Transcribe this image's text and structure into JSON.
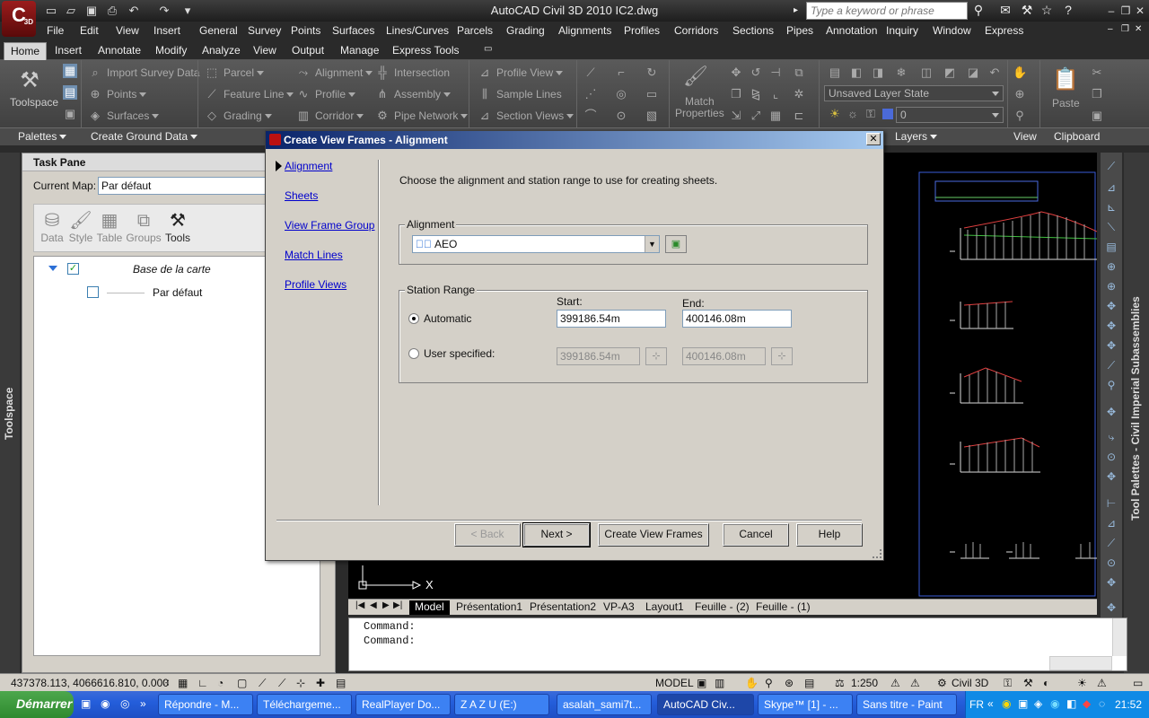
{
  "window": {
    "title": "AutoCAD Civil 3D 2010     IC2.dwg",
    "logo_sub": "3D",
    "search_placeholder": "Type a keyword or phrase"
  },
  "menubar": [
    "File",
    "Edit",
    "View",
    "Insert",
    "General",
    "Survey",
    "Points",
    "Surfaces",
    "Lines/Curves",
    "Parcels",
    "Grading",
    "Alignments",
    "Profiles",
    "Corridors",
    "Sections",
    "Pipes",
    "Annotation",
    "Inquiry",
    "Window",
    "Express"
  ],
  "ribbon_tabs": [
    "Home",
    "Insert",
    "Annotate",
    "Modify",
    "Analyze",
    "View",
    "Output",
    "Manage",
    "Express Tools"
  ],
  "ribbon": {
    "toolspace": "Toolspace",
    "import_survey": "Import Survey Data",
    "points": "Points",
    "surfaces": "Surfaces",
    "parcel": "Parcel",
    "feature_line": "Feature Line",
    "grading": "Grading",
    "alignment": "Alignment",
    "profile": "Profile",
    "corridor": "Corridor",
    "intersection": "Intersection",
    "assembly": "Assembly",
    "pipe_network": "Pipe Network",
    "profile_view": "Profile View",
    "sample_lines": "Sample Lines",
    "section_views": "Section Views",
    "match_properties": "Match\nProperties",
    "layer_state": "Unsaved Layer State",
    "layer_value": "0",
    "paste": "Paste",
    "panels": [
      "Palettes",
      "Create Ground Data",
      "Layers",
      "View",
      "Clipboard"
    ]
  },
  "left_strip": "Toolspace",
  "taskpane": {
    "title": "Task Pane",
    "map_label": "Current Map:",
    "map_value": "Par défaut",
    "tools": [
      "Data",
      "Style",
      "Table",
      "Groups",
      "Tools"
    ],
    "tree_root": "Base de la carte",
    "tree_child": "Par défaut"
  },
  "right_strip": "Tool Palettes - Civil Imperial Subassemblies",
  "drawing": {
    "axis_label": "X"
  },
  "layout_tabs": [
    "Model",
    "Présentation1",
    "Présentation2",
    "VP-A3",
    "Layout1",
    "Feuille - (2)",
    "Feuille - (1)"
  ],
  "command_lines": [
    "Command:",
    "Command:"
  ],
  "status": {
    "coords": "437378.113, 4066616.810, 0.000",
    "model": "MODEL",
    "scale": "1:250",
    "workspace": "Civil 3D"
  },
  "taskbar": {
    "start": "Démarrer",
    "tasks": [
      "Répondre - M...",
      "Téléchargeme...",
      "RealPlayer Do...",
      "Z A Z U (E:)",
      "asalah_sami7t...",
      "AutoCAD Civ...",
      "Skype™ [1] - ...",
      "Sans titre - Paint"
    ],
    "lang": "FR",
    "clock": "21:52"
  },
  "dialog": {
    "title": "Create View Frames - Alignment",
    "nav": [
      "Alignment",
      "Sheets",
      "View Frame Group",
      "Match Lines",
      "Profile Views"
    ],
    "instruction": "Choose the alignment and station range to use for creating sheets.",
    "alignment_group": "Alignment",
    "alignment_value": "AEO",
    "station_group": "Station Range",
    "start_label": "Start:",
    "end_label": "End:",
    "automatic_label": "Automatic",
    "user_label": "User specified:",
    "auto_start": "399186.54m",
    "auto_end": "400146.08m",
    "user_start": "399186.54m",
    "user_end": "400146.08m",
    "buttons": {
      "back": "< Back",
      "next": "Next >",
      "create": "Create View Frames",
      "cancel": "Cancel",
      "help": "Help"
    }
  }
}
